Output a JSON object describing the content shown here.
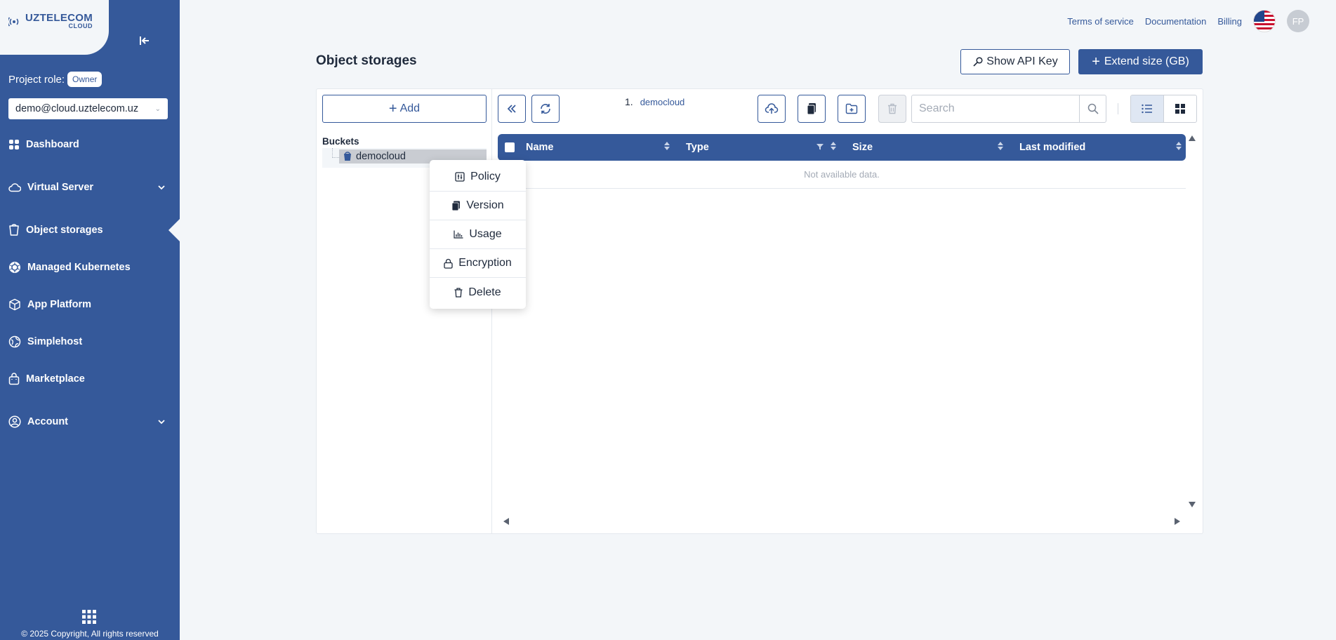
{
  "sidebar": {
    "logo_name": "UZTELECOM",
    "logo_sub": "CLOUD",
    "project_role_label": "Project role:",
    "project_role_value": "Owner",
    "project_select_value": "demo@cloud.uztelecom.uz",
    "nav": [
      {
        "label": "Dashboard",
        "icon": "dashboard-icon"
      },
      {
        "label": "Virtual Server",
        "icon": "cloud-icon",
        "expandable": true
      },
      {
        "label": "Object storages",
        "icon": "bucket-icon",
        "active": true
      },
      {
        "label": "Managed Kubernetes",
        "icon": "kubernetes-icon"
      },
      {
        "label": "App Platform",
        "icon": "box-icon"
      },
      {
        "label": "Simplehost",
        "icon": "globe-icon"
      },
      {
        "label": "Marketplace",
        "icon": "bag-icon"
      },
      {
        "label": "Account",
        "icon": "user-icon",
        "expandable": true
      }
    ],
    "copyright": "© 2025 Copyright, All rights reserved"
  },
  "topbar": {
    "links": [
      "Terms of service",
      "Documentation",
      "Billing"
    ],
    "avatar_initials": "FP"
  },
  "header": {
    "title": "Object storages",
    "show_api_key": "Show API Key",
    "extend_size": "Extend size (GB)"
  },
  "left_pane": {
    "add_label": "Add",
    "buckets_label": "Buckets",
    "bucket_name": "democloud"
  },
  "breadcrumb": {
    "index": "1.",
    "path": "democloud"
  },
  "search": {
    "placeholder": "Search"
  },
  "grid": {
    "columns": [
      "Name",
      "Type",
      "Size",
      "Last modified"
    ],
    "empty_text": "Not available data."
  },
  "context_menu": {
    "items": [
      {
        "label": "Policy",
        "icon": "policy-icon"
      },
      {
        "label": "Version",
        "icon": "version-icon"
      },
      {
        "label": "Usage",
        "icon": "chart-icon"
      },
      {
        "label": "Encryption",
        "icon": "lock-icon"
      },
      {
        "label": "Delete",
        "icon": "trash-icon"
      }
    ]
  },
  "colors": {
    "brand": "#35599a",
    "background": "#f3f6f9"
  }
}
